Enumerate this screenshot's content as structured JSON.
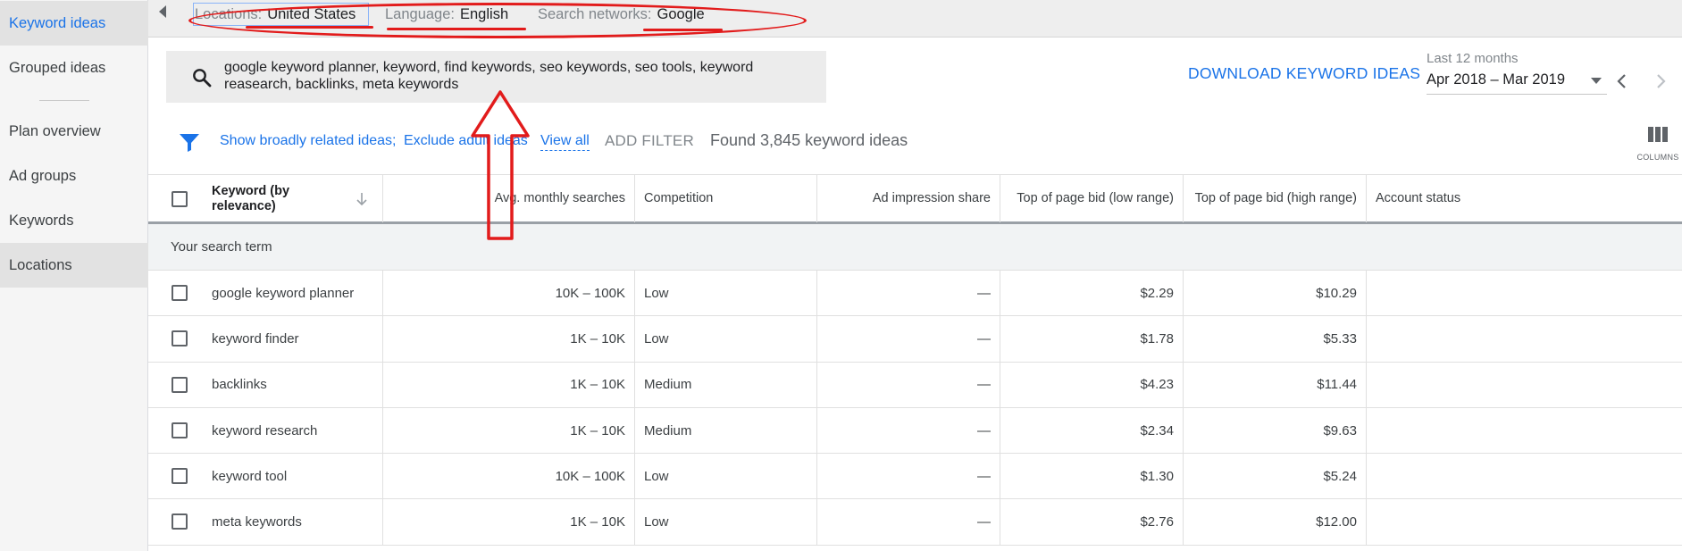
{
  "sidebar": {
    "items": [
      {
        "label": "Keyword ideas"
      },
      {
        "label": "Grouped ideas"
      },
      {
        "label": "Plan overview"
      },
      {
        "label": "Ad groups"
      },
      {
        "label": "Keywords"
      },
      {
        "label": "Locations"
      }
    ],
    "active_item": "Keyword ideas",
    "selected_item": "Locations"
  },
  "topbar": {
    "locations_key": "Locations:",
    "locations_value": "United States",
    "language_key": "Language:",
    "language_value": "English",
    "networks_key": "Search networks:",
    "networks_value": "Google"
  },
  "search": {
    "text": "google keyword planner, keyword, find keywords, seo keywords, seo tools, keyword reasearch, backlinks, meta keywords"
  },
  "actions": {
    "download_label": "DOWNLOAD KEYWORD IDEAS"
  },
  "date_range": {
    "caption": "Last 12 months",
    "value": "Apr 2018 – Mar 2019"
  },
  "filters": {
    "broad_label": "Show broadly related ideas;",
    "adult_label": "Exclude adult ideas",
    "view_all_label": "View all",
    "add_filter_label": "ADD FILTER",
    "found_text": "Found 3,845 keyword ideas",
    "columns_label": "COLUMNS"
  },
  "table": {
    "headers": {
      "keyword": "Keyword (by relevance)",
      "avg_searches": "Avg. monthly searches",
      "competition": "Competition",
      "ad_impression": "Ad impression share",
      "bid_low": "Top of page bid (low range)",
      "bid_high": "Top of page bid (high range)",
      "account_status": "Account status"
    },
    "section_label": "Your search term",
    "rows": [
      {
        "keyword": "google keyword planner",
        "searches": "10K – 100K",
        "competition": "Low",
        "impression": "—",
        "bid_low": "$2.29",
        "bid_high": "$10.29"
      },
      {
        "keyword": "keyword finder",
        "searches": "1K – 10K",
        "competition": "Low",
        "impression": "—",
        "bid_low": "$1.78",
        "bid_high": "$5.33"
      },
      {
        "keyword": "backlinks",
        "searches": "1K – 10K",
        "competition": "Medium",
        "impression": "—",
        "bid_low": "$4.23",
        "bid_high": "$11.44"
      },
      {
        "keyword": "keyword research",
        "searches": "1K – 10K",
        "competition": "Medium",
        "impression": "—",
        "bid_low": "$2.34",
        "bid_high": "$9.63"
      },
      {
        "keyword": "keyword tool",
        "searches": "10K – 100K",
        "competition": "Low",
        "impression": "—",
        "bid_low": "$1.30",
        "bid_high": "$5.24"
      },
      {
        "keyword": "meta keywords",
        "searches": "1K – 10K",
        "competition": "Low",
        "impression": "—",
        "bid_low": "$2.76",
        "bid_high": "$12.00"
      }
    ]
  },
  "colors": {
    "accent": "#1a73e8",
    "annotation": "#e21b1b"
  }
}
